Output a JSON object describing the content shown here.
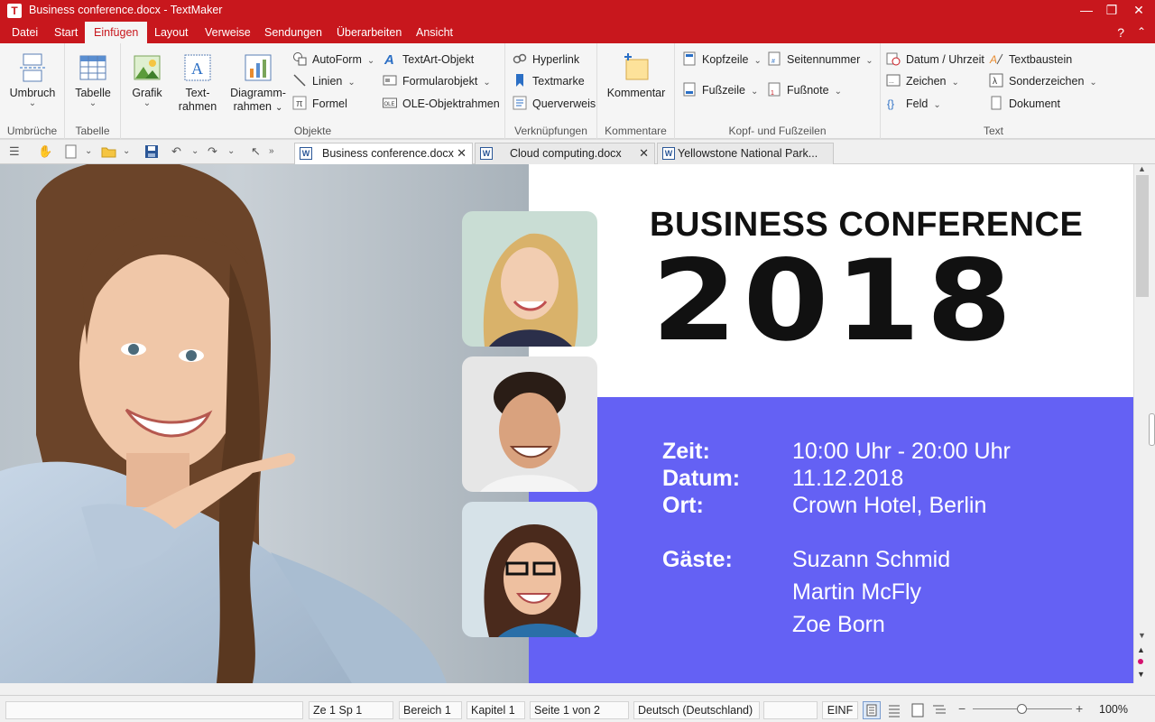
{
  "window": {
    "title": "Business conference.docx - TextMaker",
    "app_icon": "T",
    "controls": [
      "minimize-icon",
      "restore-icon",
      "close-icon"
    ]
  },
  "menu": {
    "tabs": [
      "Datei",
      "Start",
      "Einfügen",
      "Layout",
      "Verweise",
      "Sendungen",
      "Überarbeiten",
      "Ansicht"
    ],
    "active_tab": "Einfügen",
    "help": "?"
  },
  "ribbon": {
    "groups": {
      "umbrueche": "Umbrüche",
      "tabelle": "Tabelle",
      "objekte": "Objekte",
      "verknuepfungen": "Verknüpfungen",
      "kommentare": "Kommentare",
      "kopf_fusszeilen": "Kopf- und Fußzeilen",
      "text": "Text"
    },
    "umbruch": "Umbruch",
    "tabelle": "Tabelle",
    "grafik": "Grafik",
    "textrahmen_1": "Text-",
    "textrahmen_2": "rahmen",
    "diagramm_1": "Diagramm-",
    "diagramm_2": "rahmen",
    "autoform": "AutoForm",
    "linien": "Linien",
    "formel": "Formel",
    "textart": "TextArt-Objekt",
    "formularobjekt": "Formularobjekt",
    "ole": "OLE-Objektrahmen",
    "hyperlink": "Hyperlink",
    "textmarke": "Textmarke",
    "querverweis": "Querverweis",
    "kommentar": "Kommentar",
    "kopfzeile": "Kopfzeile",
    "fusszeile": "Fußzeile",
    "seitennummer": "Seitennummer",
    "fussnote": "Fußnote",
    "datum": "Datum / Uhrzeit",
    "zeichen": "Zeichen",
    "feld": "Feld",
    "textbaustein": "Textbaustein",
    "sonderzeichen": "Sonderzeichen",
    "dokument": "Dokument"
  },
  "document_tabs": [
    {
      "label": "Business conference.docx",
      "active": true
    },
    {
      "label": "Cloud computing.docx",
      "active": false
    },
    {
      "label": "Yellowstone National Park...",
      "active": false
    }
  ],
  "document": {
    "headline": "BUSINESS CONFERENCE",
    "year": "2018",
    "details": [
      {
        "label": "Zeit:",
        "value": "10:00 Uhr - 20:00 Uhr"
      },
      {
        "label": "Datum:",
        "value": "11.12.2018"
      },
      {
        "label": "Ort:",
        "value": "Crown Hotel, Berlin"
      }
    ],
    "guests_label": "Gäste:",
    "guests": [
      "Suzann Schmid",
      "Martin McFly",
      "Zoe Born"
    ],
    "accent_color": "#6461f4"
  },
  "status": {
    "position": "Ze 1 Sp 1",
    "bereich": "Bereich 1",
    "kapitel": "Kapitel 1",
    "seite": "Seite 1 von 2",
    "sprache": "Deutsch (Deutschland)",
    "mode": "EINF",
    "zoom": "100%",
    "zoom_level_fraction": 0.5
  },
  "colors": {
    "brand": "#c8171d",
    "ribbon_bg": "#f5f5f5"
  }
}
